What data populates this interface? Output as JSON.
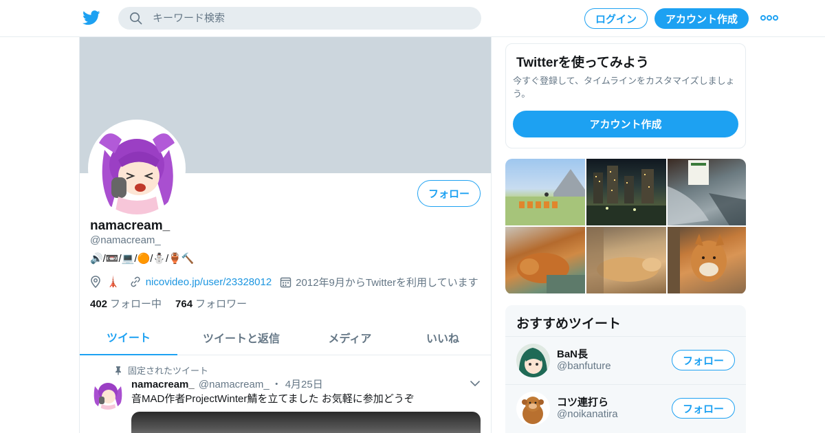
{
  "header": {
    "search_placeholder": "キーワード検索",
    "login_label": "ログイン",
    "signup_label": "アカウント作成",
    "brand_color": "#1da1f2"
  },
  "profile": {
    "display_name": "namacream_",
    "screen_name": "@namacream_",
    "bio": "🔊/📼/💻/🟠/⛄/🏺🔨",
    "location_emoji": "🗼",
    "url": "nicovideo.jp/user/23328012",
    "joined": "2012年9月からTwitterを利用しています",
    "following_count": "402",
    "following_label": "フォロー中",
    "followers_count": "764",
    "followers_label": "フォロワー",
    "follow_label": "フォロー"
  },
  "tabs": [
    {
      "label": "ツイート",
      "active": true
    },
    {
      "label": "ツイートと返信",
      "active": false
    },
    {
      "label": "メディア",
      "active": false
    },
    {
      "label": "いいね",
      "active": false
    }
  ],
  "pinned_tweet": {
    "pinned_label": "固定されたツイート",
    "author_name": "namacream_",
    "author_screen_name": "@namacream_",
    "separator": "・",
    "date": "4月25日",
    "text": "音MAD作者ProjectWinter鯖を立てました お気軽に参加どうぞ"
  },
  "signup_card": {
    "title": "Twitterを使ってみよう",
    "description": "今すぐ登録して、タイムラインをカスタマイズしましょう。",
    "button_label": "アカウント作成"
  },
  "recommended": {
    "title": "おすすめツイート",
    "users": [
      {
        "name": "BaN長",
        "screen_name": "@banfuture",
        "follow_label": "フォロー"
      },
      {
        "name": "コツ連打ら",
        "screen_name": "@noikanatira",
        "follow_label": "フォロー"
      }
    ]
  }
}
